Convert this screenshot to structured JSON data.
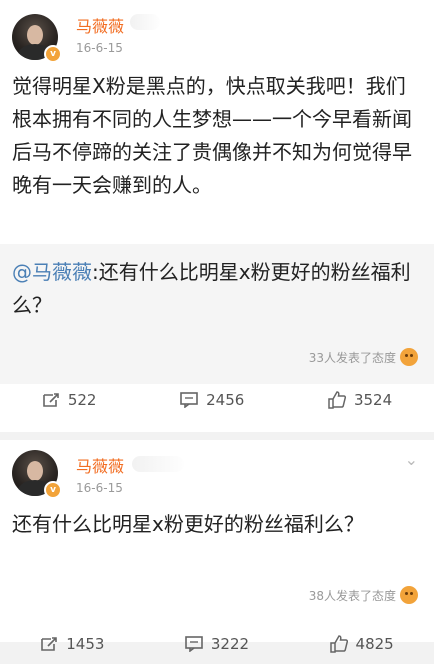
{
  "posts": [
    {
      "username": "马薇薇",
      "time": "16-6-15",
      "text": "觉得明星X粉是黑点的，快点取关我吧！我们根本拥有不同的人生梦想——一个今早看新闻后马不停蹄的关注了贵偶像并不知为何觉得早晚有一天会赚到的人。",
      "quote": {
        "mention": "@马薇薇",
        "text": ":还有什么比明星x粉更好的粉丝福利么？",
        "approval": "33人发表了态度"
      },
      "actions": {
        "repost": "522",
        "comment": "2456",
        "like": "3524"
      }
    },
    {
      "username": "马薇薇",
      "time": "16-6-15",
      "text": "还有什么比明星x粉更好的粉丝福利么？",
      "approval": "38人发表了态度",
      "actions": {
        "repost": "1453",
        "comment": "3222",
        "like": "4825"
      }
    }
  ],
  "colors": {
    "username": "#f26d22",
    "mention": "#4a7fb5",
    "badge": "#f2a33a"
  },
  "icons": {
    "repost": "repost-icon",
    "comment": "comment-icon",
    "like": "thumbs-up-icon",
    "badge": "verified-badge-icon"
  }
}
